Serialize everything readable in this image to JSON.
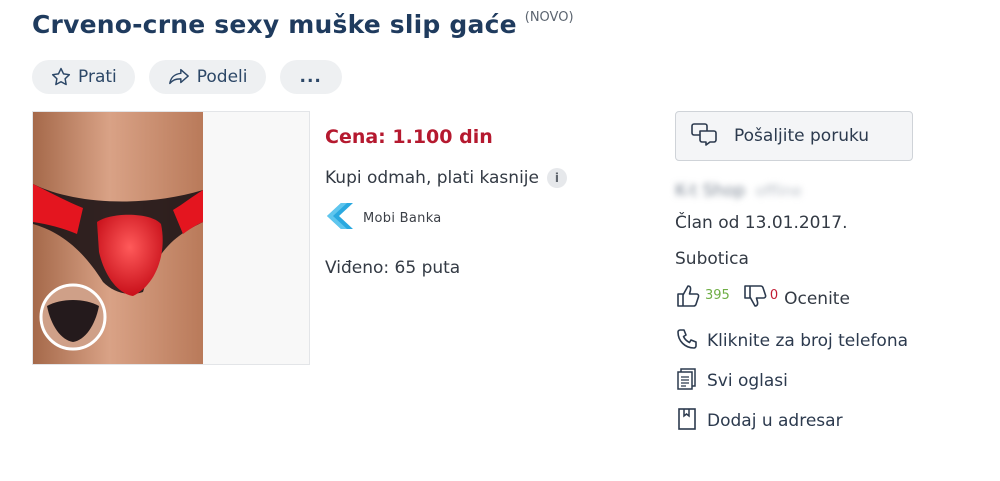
{
  "listing": {
    "title": "Crveno-crne sexy muške slip gaće",
    "condition": "(NOVO)"
  },
  "actions": {
    "follow_label": "Prati",
    "share_label": "Podeli",
    "more_label": "..."
  },
  "info": {
    "price": "Cena: 1.100 din",
    "buy_now": "Kupi odmah, plati kasnije",
    "mobi_banka": "Mobi Banka",
    "views": "Viđeno: 65 puta"
  },
  "seller": {
    "message_button": "Pošaljite poruku",
    "name": "K-t Shop",
    "status": "offline",
    "member_since": "Član od 13.01.2017.",
    "city": "Subotica",
    "positive_count": "395",
    "negative_count": "0",
    "rate_label": "Ocenite",
    "phone_link": "Kliknite za broj telefona",
    "all_ads_link": "Svi oglasi",
    "address_book_link": "Dodaj u adresar"
  },
  "colors": {
    "title": "#1f3b5e",
    "price": "#b5192f",
    "positive": "#6fae45",
    "negative": "#c11b32",
    "mobi_brand": "#2aa9e0"
  },
  "icons": [
    "star-icon",
    "share-icon",
    "chat-icon",
    "thumbs-up-icon",
    "thumbs-down-icon",
    "phone-icon",
    "ads-list-icon",
    "bookmark-icon",
    "info-icon",
    "mobi-banka-logo"
  ]
}
